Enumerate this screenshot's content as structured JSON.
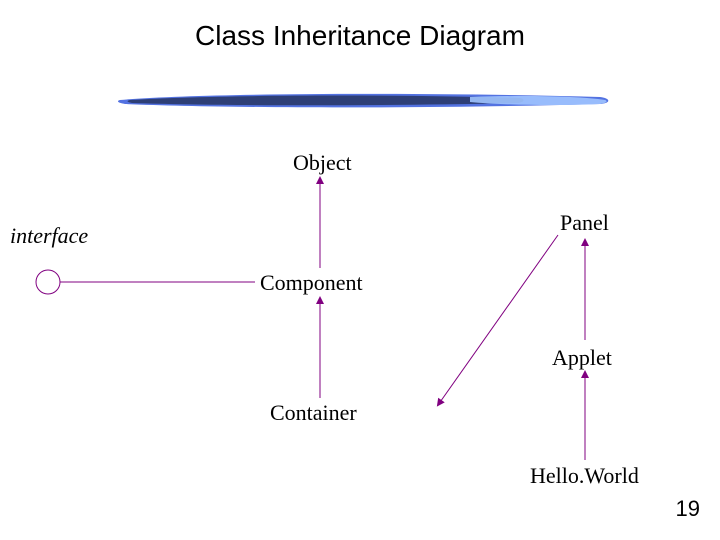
{
  "title": "Class Inheritance Diagram",
  "interface_label": "interface",
  "nodes": {
    "object": "Object",
    "panel": "Panel",
    "component": "Component",
    "applet": "Applet",
    "container": "Container",
    "helloworld": "Hello.World"
  },
  "page_number": "19",
  "colors": {
    "arrow": "#800080",
    "underline_dark": "#2a3a6a",
    "underline_mid": "#4a6adf",
    "underline_light": "#a0c4ff"
  }
}
